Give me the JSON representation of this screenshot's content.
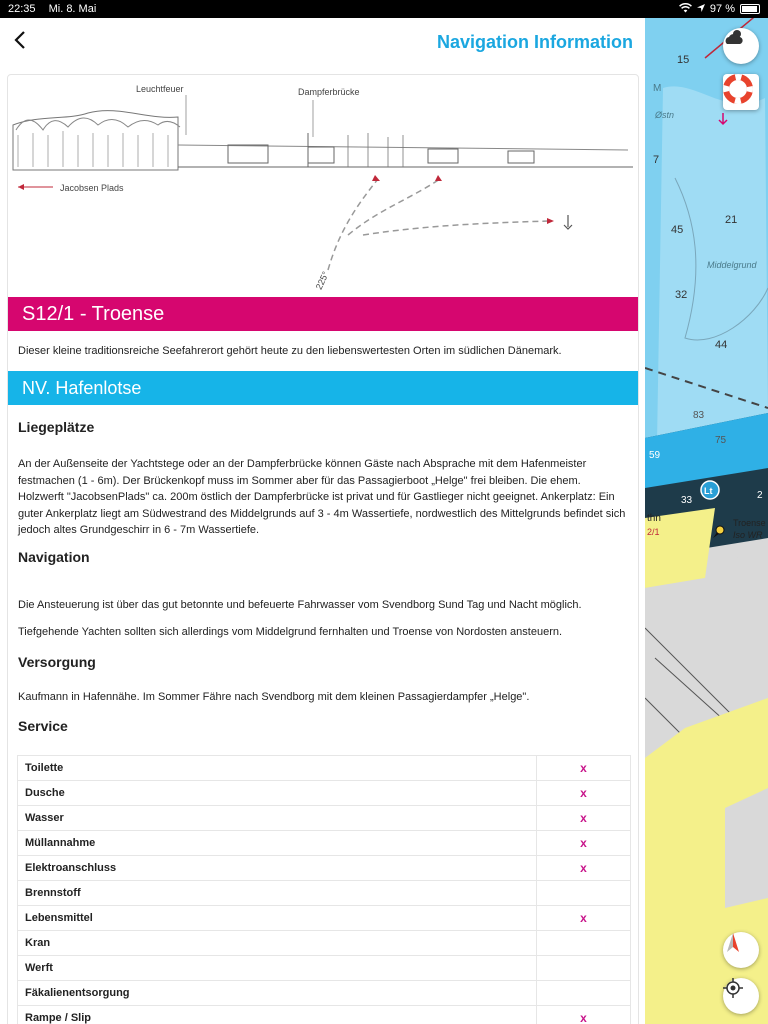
{
  "status": {
    "time": "22:35",
    "date": "Mi. 8. Mai",
    "battery": "97 %"
  },
  "nav": {
    "title": "Navigation Information"
  },
  "sketch": {
    "label_lighthouse": "Leuchtfeuer",
    "label_pier": "Dampferbrücke",
    "label_plads": "Jacobsen Plads",
    "label_bearing": "225°"
  },
  "header": {
    "title": "S12/1 - Troense"
  },
  "intro": "Dieser kleine traditionsreiche Seefahrerort gehört heute zu den liebenswertesten Orten im südlichen Dänemark.",
  "harbor_pilot": "NV. Hafenlotse",
  "sections": {
    "berths_title": "Liegeplätze",
    "berths_text": "An der Außenseite der Yachtstege oder an der Dampferbrücke können Gäste nach Absprache mit dem Hafenmeister festmachen (1 - 6m). Der Brückenkopf muss im Sommer aber für das Passagierboot „Helge\" frei bleiben. Die ehem. Holzwerft \"JacobsenPlads\" ca. 200m östlich der Dampferbrücke ist privat und für Gastlieger nicht geeignet. Ankerplatz: Ein guter Ankerplatz liegt am Südwestrand des Middelgrunds auf 3 - 4m Wassertiefe, nordwestlich des Mittelgrunds befindet sich jedoch altes Grundgeschirr in 6 - 7m Wassertiefe.",
    "navigation_title": "Navigation",
    "navigation_text1": "Die Ansteuerung ist über das gut betonnte und befeuerte Fahrwasser vom Svendborg Sund Tag und Nacht möglich.",
    "navigation_text2": "Tiefgehende Yachten sollten sich allerdings vom Middelgrund fernhalten und Troense von Nordosten ansteuern.",
    "supply_title": "Versorgung",
    "supply_text": "Kaufmann in Hafennähe. Im Sommer Fähre nach Svendborg mit dem kleinen Passagierdampfer „Helge\".",
    "service_title": "Service"
  },
  "service": [
    {
      "name": "Toilette",
      "mark": "x"
    },
    {
      "name": "Dusche",
      "mark": "x"
    },
    {
      "name": "Wasser",
      "mark": "x"
    },
    {
      "name": "Müllannahme",
      "mark": "x"
    },
    {
      "name": "Elektroanschluss",
      "mark": "x"
    },
    {
      "name": "Brennstoff",
      "mark": ""
    },
    {
      "name": "Lebensmittel",
      "mark": "x"
    },
    {
      "name": "Kran",
      "mark": ""
    },
    {
      "name": "Werft",
      "mark": ""
    },
    {
      "name": "Fäkalienentsorgung",
      "mark": ""
    },
    {
      "name": "Rampe / Slip",
      "mark": "x"
    }
  ],
  "map": {
    "depths": [
      "15",
      "7",
      "45",
      "21",
      "32",
      "44",
      "83",
      "75",
      "59",
      "33",
      "2"
    ],
    "labels": [
      "M",
      "Østn",
      "Middelgrund",
      "Troense",
      "Iso WR",
      "Lt",
      "thn",
      "2/1"
    ]
  }
}
